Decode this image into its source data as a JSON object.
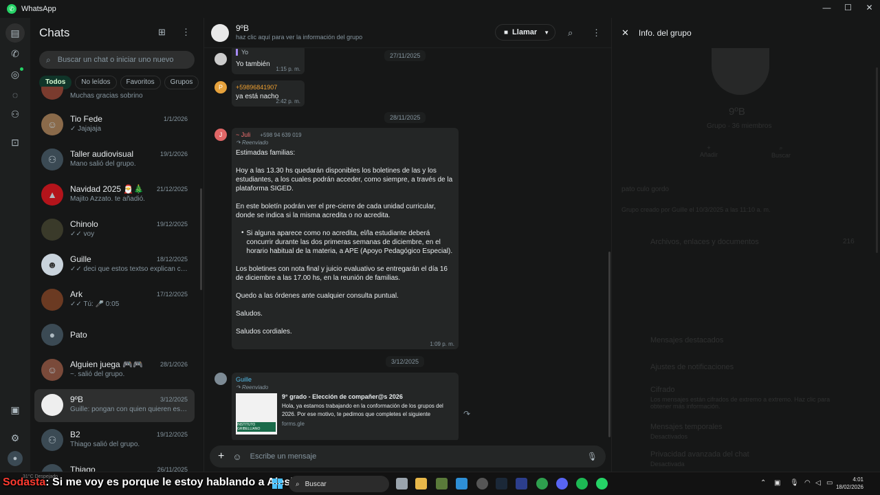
{
  "window": {
    "title": "WhatsApp",
    "controls": [
      "—",
      "☐",
      "✕"
    ]
  },
  "rail": {
    "badge_color": "#25d366"
  },
  "chatlist": {
    "title": "Chats",
    "search_placeholder": "Buscar un chat o iniciar uno nuevo",
    "filters": [
      "Todos",
      "No leídos",
      "Favoritos",
      "Grupos"
    ],
    "items": [
      {
        "name": "",
        "date": "",
        "preview": "Muchas gracias sobrino"
      },
      {
        "name": "Tio Fede",
        "date": "1/1/2026",
        "preview": "✓ Jajajaja"
      },
      {
        "name": "Taller audiovisual",
        "date": "19/1/2026",
        "preview": "Mano salió del grupo."
      },
      {
        "name": "Navidad 2025 🎅🎄",
        "date": "21/12/2025",
        "preview": "Majito Azzato. te añadió."
      },
      {
        "name": "Chinolo",
        "date": "19/12/2025",
        "preview": "✓✓ voy"
      },
      {
        "name": "Guille",
        "date": "18/12/2025",
        "preview": "✓✓ deci que estos textso explican con ..."
      },
      {
        "name": "Ark",
        "date": "17/12/2025",
        "preview": "✓✓ Tú: 🎤 0:05"
      },
      {
        "name": "Pato",
        "date": "",
        "preview": ""
      },
      {
        "name": "Alguien juega 🎮🎮",
        "date": "28/1/2026",
        "preview": "~. salió del grupo."
      },
      {
        "name": "9ºB",
        "date": "3/12/2025",
        "preview": "Guille: pongan con quien quieren estar ..."
      },
      {
        "name": "B2",
        "date": "19/12/2025",
        "preview": "Thiago salió del grupo."
      },
      {
        "name": "Thiago",
        "date": "26/11/2025",
        "preview": ""
      }
    ]
  },
  "chat": {
    "name": "9ºB",
    "subtitle": "haz clic aquí para ver la información del grupo",
    "call_label": "Llamar",
    "dates": [
      "27/11/2025",
      "28/11/2025",
      "3/12/2025"
    ],
    "m1": {
      "quote": "Yo",
      "text": "Yo también",
      "time": "1:15 p. m."
    },
    "m2": {
      "sender": "+59896841907",
      "text": "ya está nacho",
      "time": "2:42 p. m.",
      "avatar": "P"
    },
    "m3": {
      "sender": "~ Juli",
      "phone": "+598 94 639 019",
      "forwarded": "Reenviado",
      "avatar": "J",
      "p1": "Estimadas familias:",
      "p2": "Hoy a las 13.30 hs quedarán disponibles los boletines de las y los estudiantes, a los cuales podrán acceder, como siempre, a través de la plataforma SIGED.",
      "p3": "En este boletín podrán ver el pre-cierre de cada unidad curricular, donde se indica si la misma acredita o no acredita.",
      "p4": "Si alguna aparece como no acredita, el/la estudiante deberá concurrir durante las dos primeras semanas de diciembre, en el horario habitual de la materia, a APE (Apoyo Pedagógico Especial).",
      "p5": "Los boletines con nota final y juicio evaluativo se entregarán el día 16 de diciembre a las 17.00 hs, en la reunión de familias.",
      "p6": "Quedo a las órdenes ante cualquier consulta puntual.",
      "p7": "Saludos.",
      "p8": "Saludos cordiales.",
      "time": "1:09 p. m."
    },
    "m4": {
      "sender": "Guille",
      "forwarded": "Reenviado",
      "link_title": "9° grado - Elección de compañer@s 2026",
      "link_desc": "Hola, ya estamos trabajando en la conformación de los grupos del 2026. Por ese motivo, te pedimos que completes el siguiente",
      "link_domain": "forms.gle",
      "thumb_label": "INSTITUTO GRIBELLIANO"
    },
    "composer_placeholder": "Escribe un mensaje"
  },
  "info": {
    "title": "Info. del grupo",
    "group_name": "9ºB",
    "group_meta": "Grupo · 36 miembros",
    "add_label": "Añadir",
    "search_label": "Buscar",
    "description": "pato culo gordo",
    "created": "Grupo creado por Guille el 10/3/2025 a las 11:10 a. m.",
    "media_label": "Archivos, enlaces y documentos",
    "media_count": "216",
    "starred": "Mensajes destacados",
    "notifications": "Ajustes de notificaciones",
    "encryption": "Cifrado",
    "encryption_sub": "Los mensajes están cifrados de extremo a extremo. Haz clic para obtener más información.",
    "temp": "Mensajes temporales",
    "temp_sub": "Desactivados",
    "privacy": "Privacidad avanzada del chat",
    "privacy_sub": "Desactivada"
  },
  "taskbar": {
    "subtitle_red": "Sodasta",
    "subtitle_white": ": Si me voy es porque le estoy hablando a Alesi",
    "weather": "31°C Despejado",
    "search": "Buscar",
    "time": "4:01",
    "date": "18/02/2026"
  }
}
